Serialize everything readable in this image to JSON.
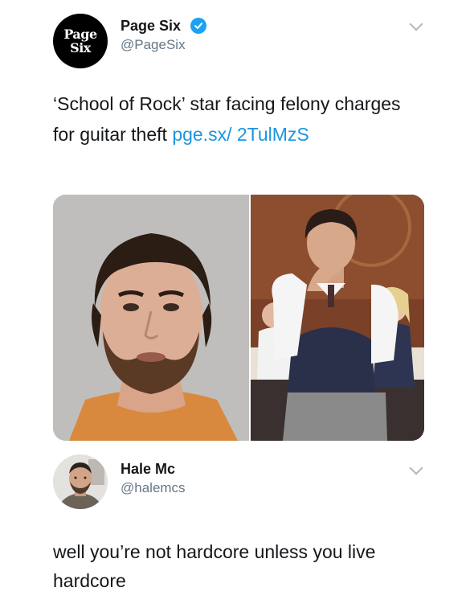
{
  "tweet1": {
    "avatar_line1": "Page",
    "avatar_line2": "Six",
    "display_name": "Page Six",
    "handle": "@PageSix",
    "text": "‘School of Rock’ star facing felony charges for guitar theft ",
    "link": "pge.sx/ 2TulMzS"
  },
  "tweet2": {
    "display_name": "Hale Mc",
    "handle": "@halemcs",
    "text": "well you’re not hardcore unless you live hardcore"
  },
  "colors": {
    "link": "#1b95e0",
    "verified": "#1da1f2",
    "secondary_text": "#657786"
  },
  "icons": [
    "verified-badge-icon",
    "chevron-down-icon"
  ]
}
